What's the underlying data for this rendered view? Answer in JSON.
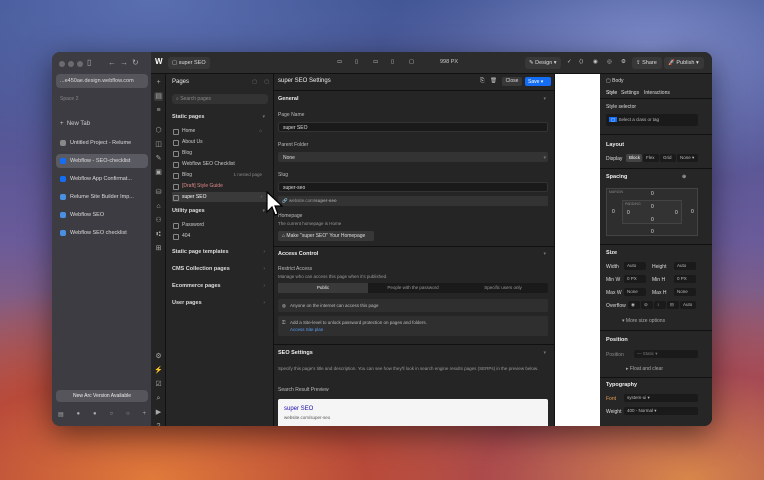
{
  "arc": {
    "url": "...e450ae.design.webflow.com",
    "space": "Space 2",
    "new_tab": "New Tab",
    "tabs": [
      {
        "label": "Untitled Project - Relume",
        "color": "#888888",
        "active": false
      },
      {
        "label": "Webflow - SEO-checklist",
        "color": "#146ef5",
        "active": true
      },
      {
        "label": "Webflow App Confirmat...",
        "color": "#146ef5",
        "active": false
      },
      {
        "label": "Relume Site Builder Imp...",
        "color": "#4a90e2",
        "active": false
      },
      {
        "label": "Webflow SEO",
        "color": "#4a90e2",
        "active": false
      },
      {
        "label": "Webflow SEO checklist",
        "color": "#4a90e2",
        "active": false
      }
    ],
    "new_version": "New Arc Version Available"
  },
  "topbar": {
    "logo": "W",
    "page": "super SEO",
    "width": "998 PX",
    "design": "Design",
    "share": "Share",
    "publish": "Publish"
  },
  "pages": {
    "title": "Pages",
    "search_placeholder": "Search pages",
    "static_header": "Static pages",
    "static": [
      {
        "label": "Home",
        "note": ""
      },
      {
        "label": "About Us",
        "note": ""
      },
      {
        "label": "Blog",
        "note": ""
      },
      {
        "label": "Webflow SEO Checklist",
        "note": ""
      },
      {
        "label": "Blog",
        "note": "1 nested page"
      },
      {
        "label": "[Draft] Style Guide",
        "note": ""
      },
      {
        "label": "super SEO",
        "note": ""
      }
    ],
    "utility_header": "Utility pages",
    "utility": [
      {
        "label": "Password"
      },
      {
        "label": "404"
      }
    ],
    "sections": [
      "Static page templates",
      "CMS Collection pages",
      "Ecommerce pages",
      "User pages"
    ]
  },
  "settings": {
    "title": "super SEO Settings",
    "close": "Close",
    "save": "Save",
    "general": "General",
    "page_name_label": "Page Name",
    "page_name": "super SEO",
    "parent_label": "Parent Folder",
    "parent": "None",
    "slug_label": "Slug",
    "slug": "super-seo",
    "slug_url_prefix": "website.com/",
    "slug_url_bold": "super-seo",
    "homepage_label": "Homepage",
    "homepage_note": "The current homepage is Home",
    "make_homepage": "Make \"super SEO\" Your Homepage",
    "access_header": "Access Control",
    "restrict_label": "Restrict Access",
    "restrict_note": "Manage who can access this page when it's published.",
    "access_options": [
      "Public",
      "People with the password",
      "Specific users only"
    ],
    "anyone": "Anyone on the internet can access this page",
    "add_site_pw": "Add a Site-level to unlock password protection on pages and folders.",
    "access_link": "Access Site plan",
    "seo_header": "SEO Settings",
    "seo_note": "Specify this page's title and description. You can see how they'll look in search engine results pages (SERPs) in the preview below.",
    "preview_label": "Search Result Preview",
    "preview_title": "super SEO",
    "preview_url": "website.com/super-seo"
  },
  "style": {
    "header": "Body",
    "tabs": [
      "Style",
      "Settings",
      "Interactions"
    ],
    "selector_label": "Style selector",
    "selector_placeholder": "Select a class or tag",
    "layout": "Layout",
    "display_label": "Display",
    "display_opts": [
      "Block",
      "Flex",
      "Grid",
      "None"
    ],
    "spacing": "Spacing",
    "margin": "MARGIN",
    "padding": "PADDING",
    "zero": "0",
    "size": "Size",
    "width_label": "Width",
    "width": "Auto",
    "height_label": "Height",
    "height": "Auto",
    "minw_label": "Min W",
    "minw": "0",
    "px": "PX",
    "minh_label": "Min H",
    "minh": "0",
    "maxw_label": "Max W",
    "maxw": "None",
    "maxh_label": "Max H",
    "maxh": "None",
    "overflow_label": "Overflow",
    "overflow_auto": "Auto",
    "more_size": "More size options",
    "position": "Position",
    "position_label": "Position",
    "position_val": "Static",
    "float_clear": "Float and clear",
    "typography": "Typography",
    "font_label": "Font",
    "font": "system-ui",
    "weight_label": "Weight",
    "weight": "400 - Normal"
  }
}
